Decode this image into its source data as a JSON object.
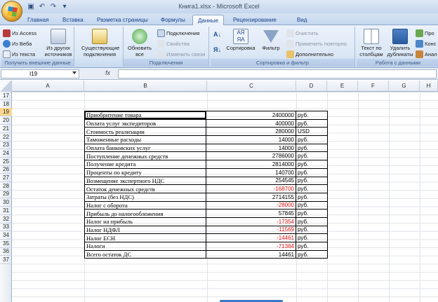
{
  "window": {
    "title": "Книга1.xlsx - Microsoft Excel"
  },
  "tabs": [
    "Главная",
    "Вставка",
    "Разметка страницы",
    "Формулы",
    "Данные",
    "Рецензирование",
    "Вид"
  ],
  "active_tab": "Данные",
  "ribbon": {
    "external": {
      "label": "Получить внешние данные",
      "access": "Из Access",
      "web": "Из Веба",
      "text": "Из текста",
      "other": "Из других источников",
      "existing": "Существующие подключения"
    },
    "connections": {
      "label": "Подключения",
      "refresh": "Обновить все",
      "connections": "Подключения",
      "properties": "Свойства",
      "edit_links": "Изменить связи"
    },
    "sortfilter": {
      "label": "Сортировка и фильтр",
      "sort": "Сортировка",
      "filter": "Фильтр",
      "clear": "Очистить",
      "reapply": "Применить повторно",
      "advanced": "Дополнительно"
    },
    "datatools": {
      "label": "Работа с данными",
      "text_to_cols": "Текст по столбцам",
      "remove_dup": "Удалить дубликаты",
      "pro": "Про",
      "kon": "Конс",
      "ana": "Анал"
    }
  },
  "formula_bar": {
    "name_box": "I19",
    "fx": "fx",
    "formula": ""
  },
  "columns": [
    "A",
    "B",
    "C",
    "D",
    "E",
    "F",
    "G",
    "H"
  ],
  "rows": [
    "17",
    "18",
    "19",
    "20",
    "21",
    "22",
    "23",
    "24",
    "25",
    "26",
    "27",
    "28",
    "29",
    "30",
    "31",
    "32",
    "33",
    "34",
    "35",
    "36",
    "37"
  ],
  "selected_row": "19",
  "table": [
    {
      "name": "Приобритение товара",
      "value": "2400000",
      "unit": "руб.",
      "neg": false
    },
    {
      "name": "Оплата услуг экспедиторов",
      "value": "400000",
      "unit": "руб.",
      "neg": false
    },
    {
      "name": "Стоимость реализации",
      "value": "280000",
      "unit": "USD",
      "neg": false
    },
    {
      "name": "Таможенные расходы",
      "value": "14000",
      "unit": "руб.",
      "neg": false
    },
    {
      "name": "Оплата банковских услуг",
      "value": "14000",
      "unit": "руб.",
      "neg": false
    },
    {
      "name": "Поступление денежных средств",
      "value": "2786000",
      "unit": "руб.",
      "neg": false
    },
    {
      "name": "Получение кредита",
      "value": "2814000",
      "unit": "руб.",
      "neg": false
    },
    {
      "name": "Проценты по кредиту",
      "value": "140700",
      "unit": "руб.",
      "neg": false
    },
    {
      "name": " Возмещение экспертного НДС",
      "value": "254545",
      "unit": "руб.",
      "neg": false
    },
    {
      "name": "Остаток денежных средств",
      "value": "-168700",
      "unit": "руб.",
      "neg": true
    },
    {
      "name": "Затраты (без НДС)",
      "value": "2714155",
      "unit": "руб.",
      "neg": false
    },
    {
      "name": "Налог с оборота",
      "value": "-28000",
      "unit": "руб.",
      "neg": true
    },
    {
      "name": "Прибыль до налогообложения",
      "value": "57845",
      "unit": "руб.",
      "neg": false
    },
    {
      "name": "Налог на прибыль",
      "value": "-17354",
      "unit": "руб.",
      "neg": true
    },
    {
      "name": "Налог НДФЛ",
      "value": "-11569",
      "unit": "руб.",
      "neg": true
    },
    {
      "name": "Налог ЕСН",
      "value": "-14461",
      "unit": "руб.",
      "neg": true
    },
    {
      "name": "Налоги",
      "value": "-71384",
      "unit": "руб.",
      "neg": true
    },
    {
      "name": "Всего остаток ДС",
      "value": "14461",
      "unit": "руб.",
      "neg": false
    }
  ]
}
